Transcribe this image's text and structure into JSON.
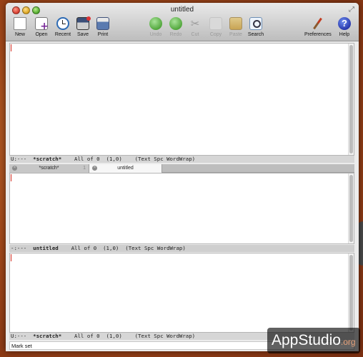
{
  "window": {
    "title": "untitled"
  },
  "toolbar": {
    "new": "New",
    "open": "Open",
    "recent": "Recent",
    "save": "Save",
    "print": "Print",
    "undo": "Undo",
    "redo": "Redo",
    "cut": "Cut",
    "copy": "Copy",
    "paste": "Paste",
    "search": "Search",
    "preferences": "Preferences",
    "help": "Help",
    "help_glyph": "?",
    "cut_glyph": "✂",
    "disabled": [
      "Undo",
      "Redo",
      "Cut",
      "Copy",
      "Paste"
    ]
  },
  "panes": {
    "top_modeline": {
      "prefix": "U:---",
      "buffer": "*scratch*",
      "position": "All of 0",
      "cursor": "(1,0)",
      "modes": "(Text Spc WordWrap)"
    },
    "tabs": [
      {
        "label": "*scratch*",
        "number": "1"
      },
      {
        "label": "untitled"
      }
    ],
    "middle_modeline": {
      "prefix": "-:---",
      "buffer": "untitled",
      "position": "All of 0",
      "cursor": "(1,0)",
      "modes": "(Text Spc WordWrap)"
    },
    "bottom_modeline": {
      "prefix": "U:---",
      "buffer": "*scratch*",
      "position": "All of 0",
      "cursor": "(1,0)",
      "modes": "(Text Spc WordWrap)"
    }
  },
  "echo_area": {
    "message": "Mark set"
  },
  "watermark": {
    "text": "AppStudio",
    "suffix": ".org"
  },
  "colors": {
    "cursor": "#d62a1e",
    "desktop": "#a2481a"
  }
}
